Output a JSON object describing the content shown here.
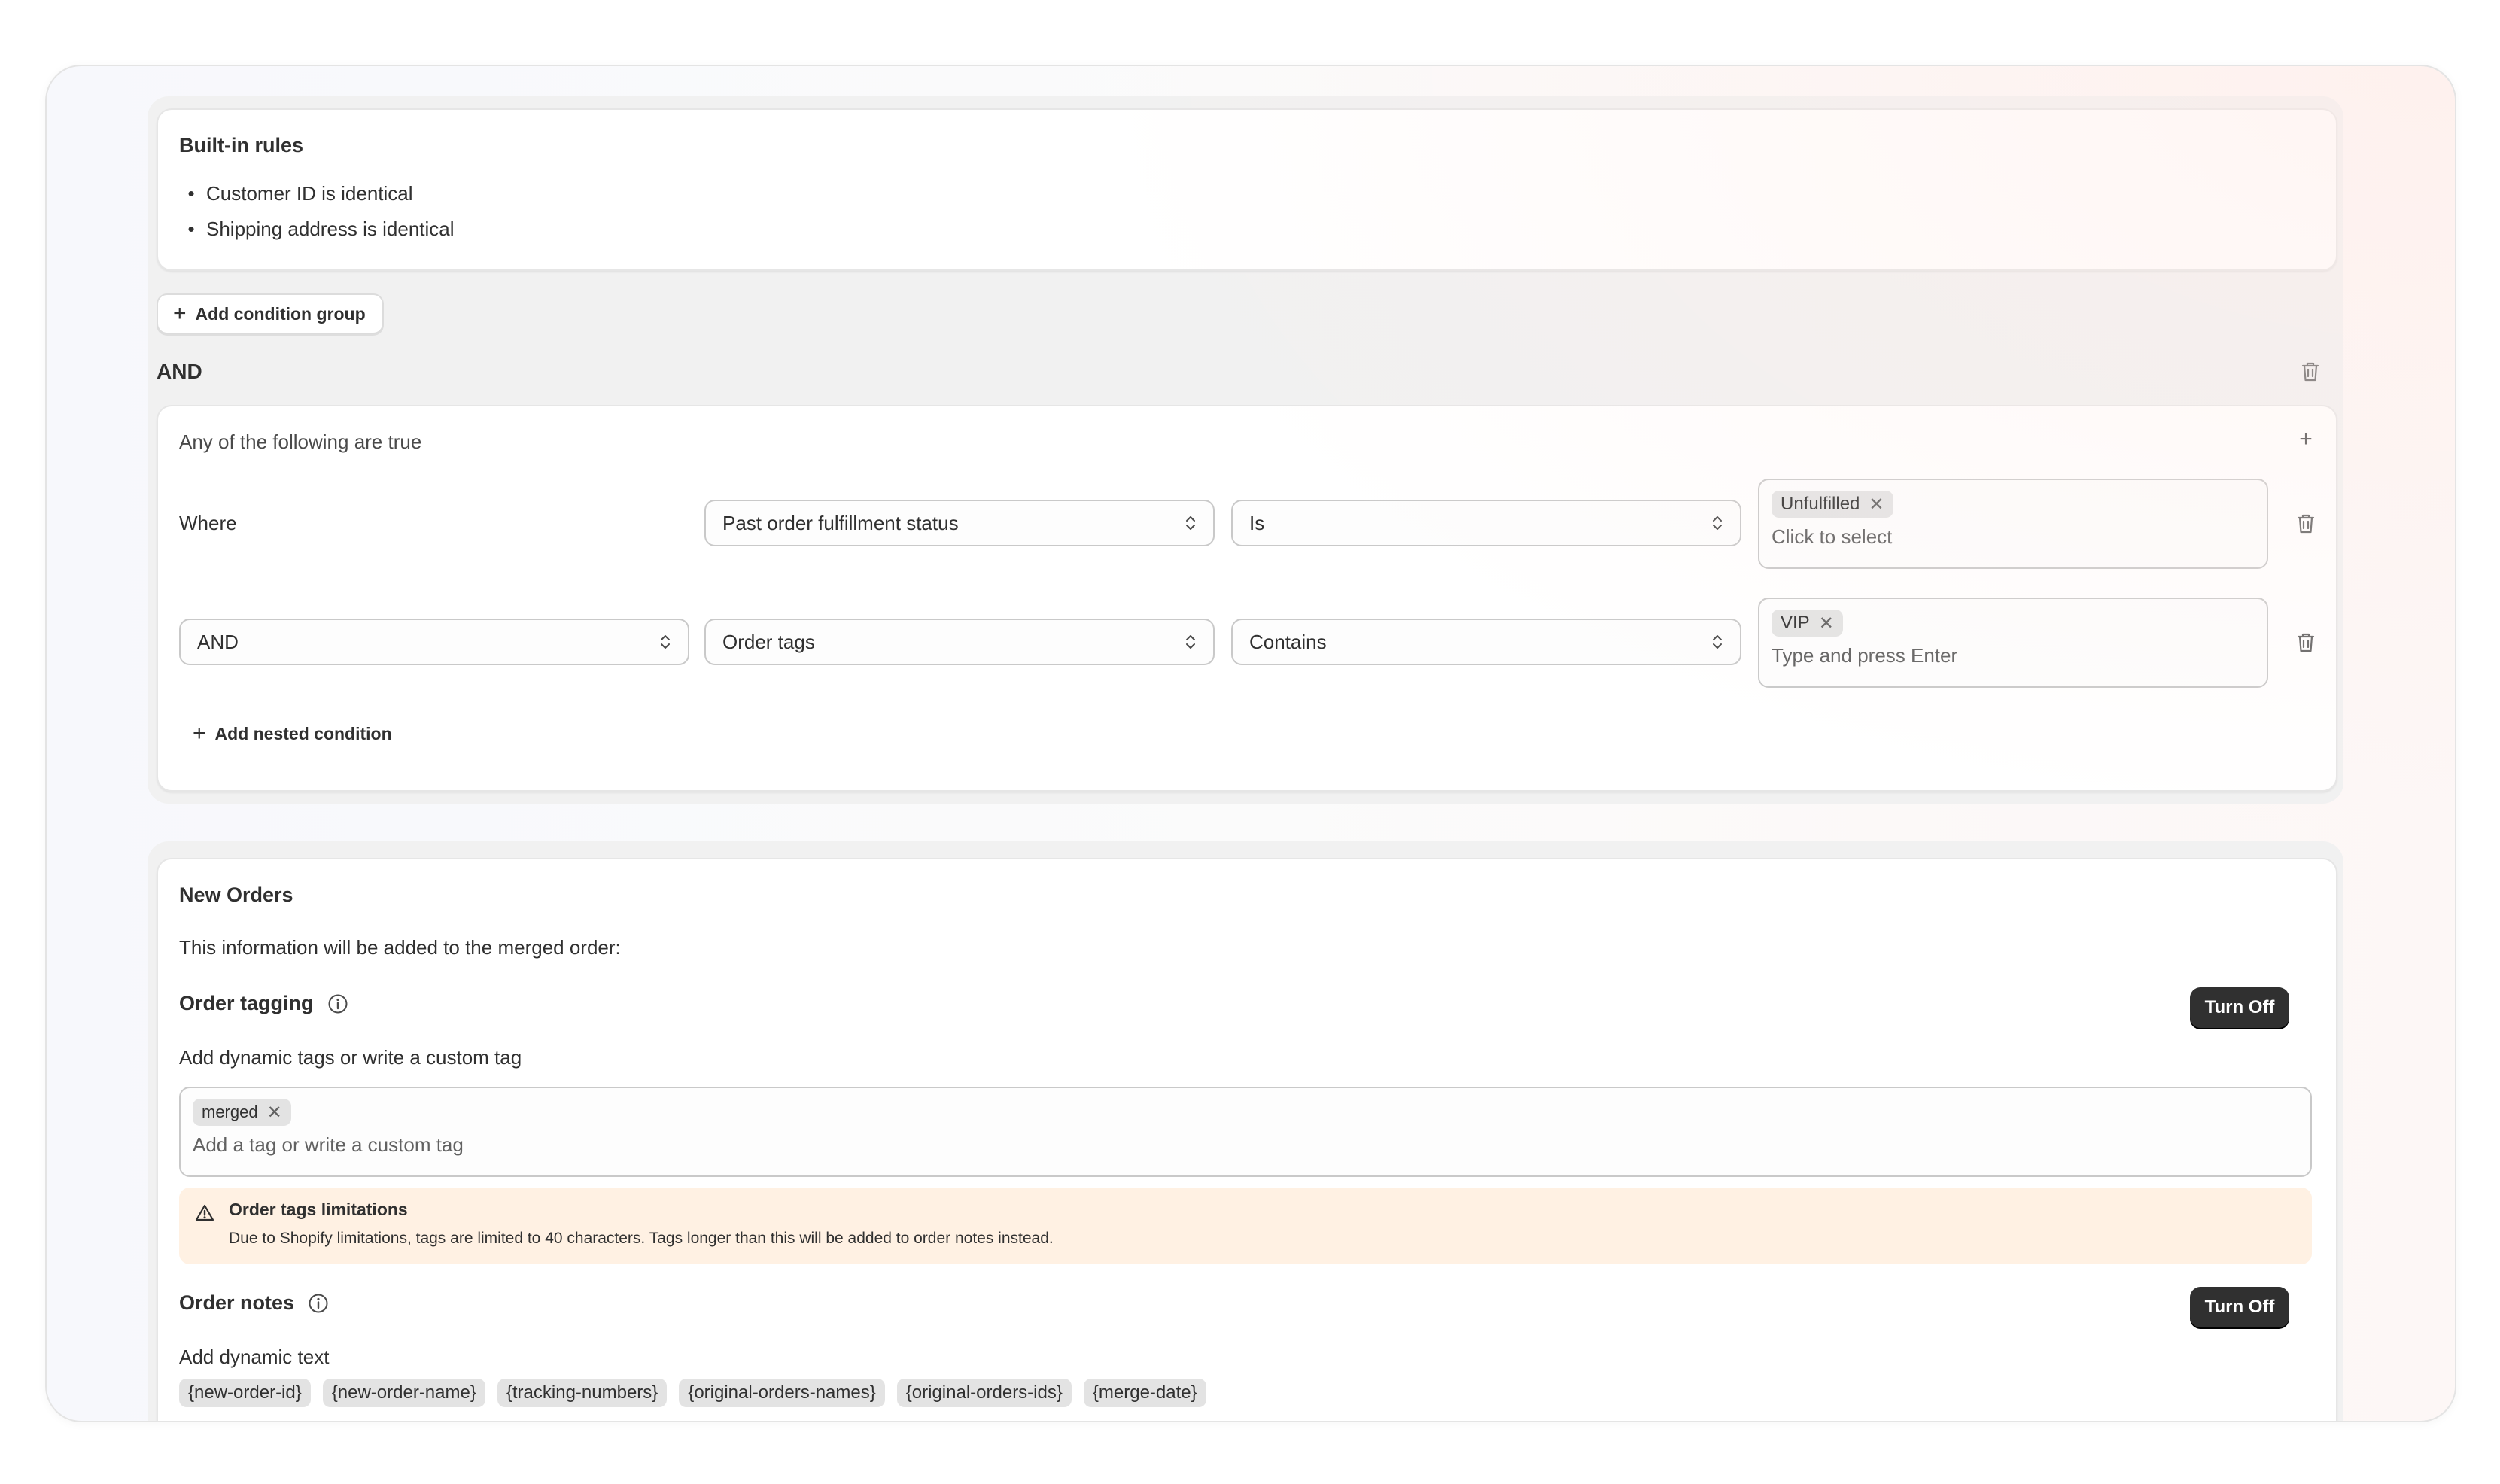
{
  "builtin": {
    "title": "Built-in rules",
    "rules": [
      "Customer ID is identical",
      "Shipping address is identical"
    ]
  },
  "add_condition_group_label": "Add condition group",
  "group": {
    "operator": "AND",
    "subtitle": "Any of the following are true",
    "row1": {
      "label": "Where",
      "field": "Past order fulfillment status",
      "comparator": "Is",
      "tags": [
        "Unfulfilled"
      ],
      "placeholder": "Click to select"
    },
    "row2": {
      "connector": "AND",
      "field": "Order tags",
      "comparator": "Contains",
      "tags": [
        "VIP"
      ],
      "placeholder": "Type and press Enter"
    },
    "add_nested_label": "Add nested condition"
  },
  "new_orders": {
    "title": "New Orders",
    "intro": "This information will be added to the merged order:",
    "tagging": {
      "title": "Order tagging",
      "button": "Turn Off",
      "help": "Add dynamic tags or write a custom tag",
      "tags": [
        "merged"
      ],
      "placeholder": "Add a tag or write a custom tag"
    },
    "warning": {
      "title": "Order tags limitations",
      "body": "Due to Shopify limitations, tags are limited to 40 characters. Tags longer than this will be added to order notes instead."
    },
    "notes": {
      "title": "Order notes",
      "button": "Turn Off",
      "help": "Add dynamic text",
      "variables": [
        "{new-order-id}",
        "{new-order-name}",
        "{tracking-numbers}",
        "{original-orders-names}",
        "{original-orders-ids}",
        "{merge-date}"
      ]
    }
  },
  "colors": {
    "primary_button": "#303030",
    "warning_bg": "#fff1e3",
    "panel_bg": "#f1f1f1"
  }
}
